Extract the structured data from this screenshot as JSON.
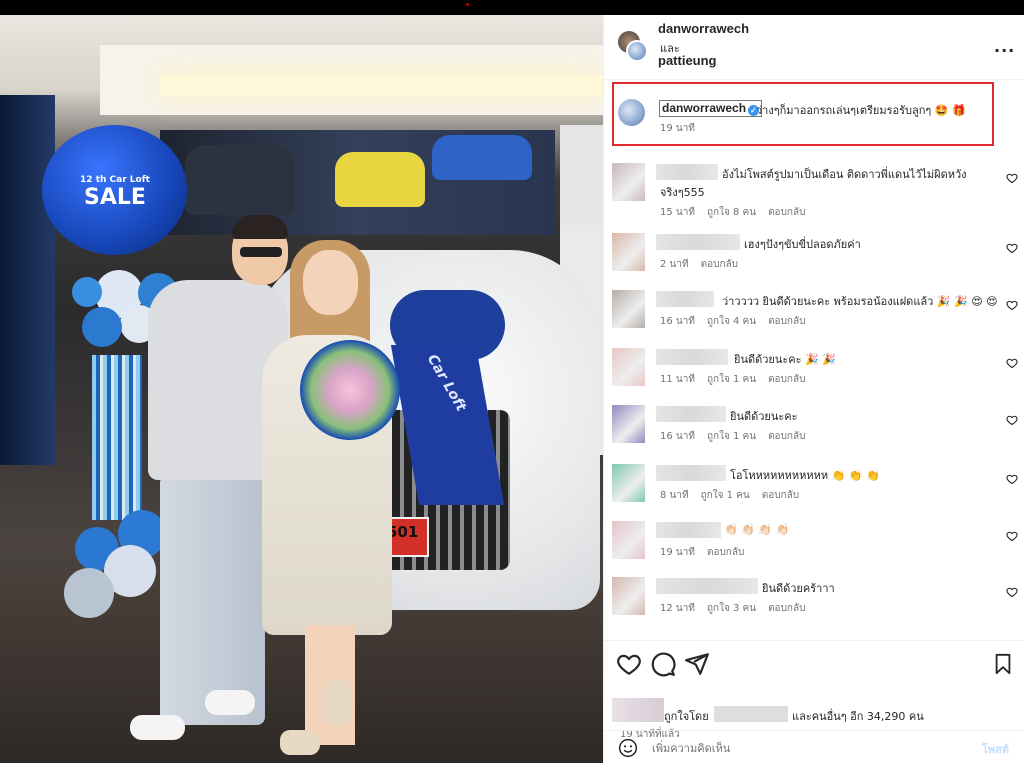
{
  "photo": {
    "balloon_line1": "12 th Car Loft",
    "balloon_line2": "SALE",
    "ribbon_text": "Car Loft",
    "plate_text": "501"
  },
  "header": {
    "user1": "danworrawech",
    "and": "และ",
    "user2": "pattieung",
    "more_label": "..."
  },
  "caption": {
    "username": "danworrawech",
    "text": "ว่างๆก็มาออกรถเล่นๆเตรียมรอรับลูกๆ 🤩 🎁",
    "time": "19 นาที"
  },
  "comments": [
    {
      "text": "อังไม่โพสต์รูปมาเป็นเดือน ติดดาวพี่แดนไว้ไม่ผิดหวัง",
      "text2": "จริงๆ555",
      "time": "15 นาที",
      "likes": "ถูกใจ 8 คน",
      "reply": "ตอบกลับ",
      "av": "#c9b8bd"
    },
    {
      "text": "เฮงๆปังๆขับขี่ปลอดภัยค่า",
      "time": "2 นาที",
      "likes": "",
      "reply": "ตอบกลับ",
      "av": "#d9b8a8"
    },
    {
      "text": "ว่าวววว ยินดีด้วยนะคะ พร้อมรอน้องแฝดแล้ว 🎉 🎉 😍 😍",
      "time": "16 นาที",
      "likes": "ถูกใจ 4 คน",
      "reply": "ตอบกลับ",
      "av": "#b5aea9"
    },
    {
      "text": "ยินดีด้วยนะคะ 🎉 🎉",
      "time": "11 นาที",
      "likes": "ถูกใจ 1 คน",
      "reply": "ตอบกลับ",
      "av": "#e8c6c4"
    },
    {
      "text": "ยินดีด้วยนะคะ",
      "time": "16 นาที",
      "likes": "ถูกใจ 1 คน",
      "reply": "ตอบกลับ",
      "av": "#8f8ac0"
    },
    {
      "text": "โอโหหหหหหหหหหห 👏 👏 👏",
      "time": "8 นาที",
      "likes": "ถูกใจ 1 คน",
      "reply": "ตอบกลับ",
      "av": "#7fc7b0"
    },
    {
      "text": "👏🏻 👏🏻 👏🏻 👏🏻",
      "time": "19 นาที",
      "likes": "",
      "reply": "ตอบกลับ",
      "av": "#e4c3c9"
    },
    {
      "text": "ยินดีด้วยคร้าาา",
      "time": "12 นาที",
      "likes": "ถูกใจ 3 คน",
      "reply": "ตอบกลับ",
      "av": "#d4b7b0"
    }
  ],
  "likes": {
    "prefix": "ถูกใจโดย",
    "suffix": "และคนอื่นๆ อีก 34,290 คน",
    "time": "19 นาทีที่แล้ว"
  },
  "add_comment": {
    "placeholder": "เพิ่มความคิดเห็น",
    "post_label": "โพสต์"
  },
  "colors": {
    "highlight_border": "#e0292a",
    "verified": "#3897f0",
    "post_button": "#c0dffd"
  },
  "icons": [
    "heart-icon",
    "comment-icon",
    "share-icon",
    "bookmark-icon",
    "emoji-icon",
    "more-icon",
    "verified-icon"
  ]
}
